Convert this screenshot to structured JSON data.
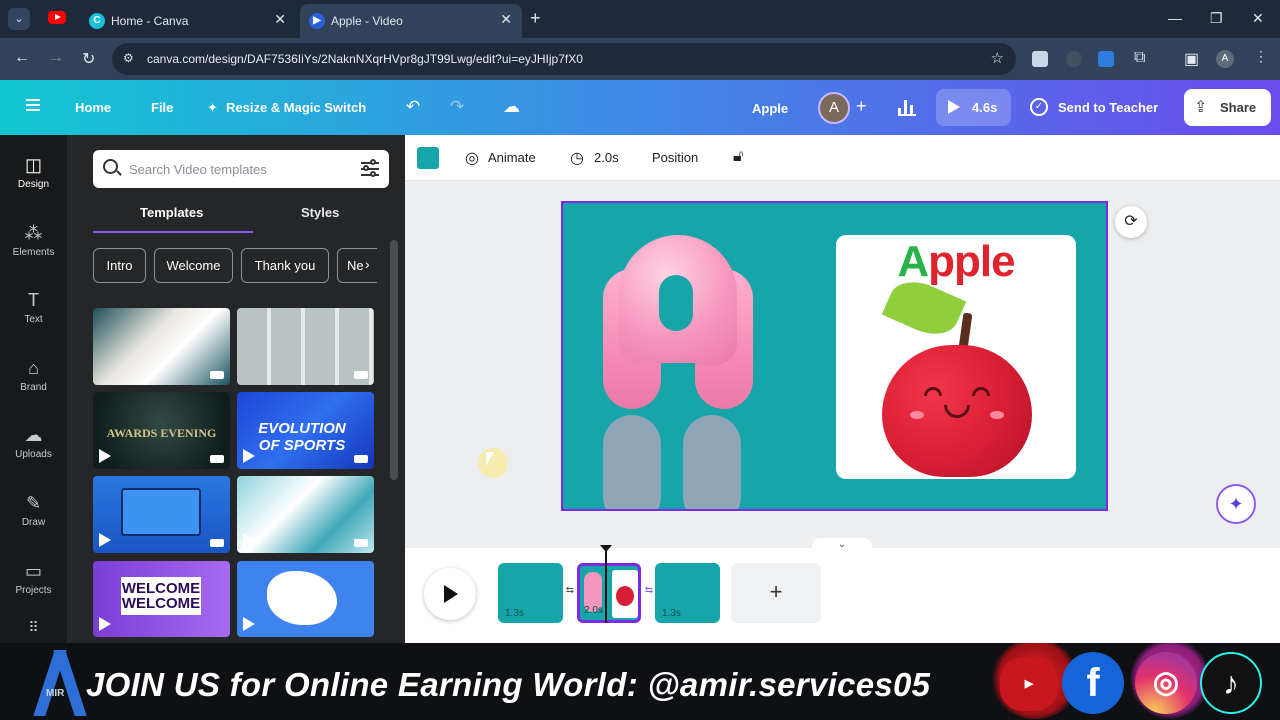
{
  "browser": {
    "tabs": [
      {
        "title": "Home - Canva",
        "favicon": "C"
      },
      {
        "title": "Apple - Video",
        "favicon": "▶"
      }
    ],
    "url": "canva.com/design/DAF7536IiYs/2NaknNXqrHVpr8gJT99Lwg/edit?ui=eyJHIjp7fX0",
    "profile_initial": "A"
  },
  "header": {
    "home": "Home",
    "file": "File",
    "resize": "Resize & Magic Switch",
    "design_title": "Apple",
    "avatar_initial": "A",
    "play_duration": "4.6s",
    "send_to_teacher": "Send to Teacher",
    "share": "Share"
  },
  "rail": [
    {
      "label": "Design",
      "icon": "layout-icon"
    },
    {
      "label": "Elements",
      "icon": "shapes-icon"
    },
    {
      "label": "Text",
      "icon": "text-icon"
    },
    {
      "label": "Brand",
      "icon": "brand-icon"
    },
    {
      "label": "Uploads",
      "icon": "cloud-upload-icon"
    },
    {
      "label": "Draw",
      "icon": "pen-icon"
    },
    {
      "label": "Projects",
      "icon": "folder-icon"
    }
  ],
  "panel": {
    "search_placeholder": "Search Video templates",
    "tabs": [
      "Templates",
      "Styles"
    ],
    "chips": [
      "Intro",
      "Welcome",
      "Thank you",
      "Ne"
    ],
    "thumb_captions": [
      "AWARDS EVENING",
      "EVOLUTION OF SPORTS",
      "WELCOME WELCOME"
    ]
  },
  "toolbar": {
    "animate": "Animate",
    "duration": "2.0s",
    "position": "Position",
    "swatch_color": "#18a5a9"
  },
  "canvas": {
    "card_title_first": "A",
    "card_title_rest": "pple",
    "background": "#18a5a9"
  },
  "timeline": {
    "clips": [
      {
        "duration": "1.3s"
      },
      {
        "duration": "2.0s"
      },
      {
        "duration": "1.3s"
      }
    ]
  },
  "banner": {
    "text": "JOIN US for Online Earning World: @amir.services05",
    "logo_text": "MIR"
  }
}
